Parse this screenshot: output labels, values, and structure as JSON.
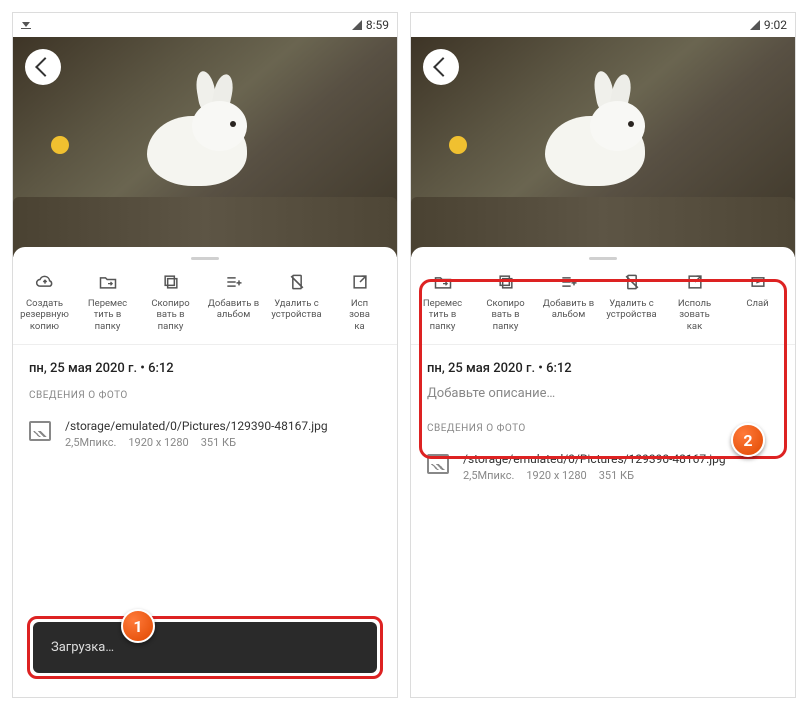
{
  "left": {
    "time": "8:59",
    "actions": [
      {
        "icon": "cloud-up",
        "label": "Создать\nрезервную\nкопию"
      },
      {
        "icon": "folder-move",
        "label": "Перемес\nтить в\nпапку"
      },
      {
        "icon": "copy",
        "label": "Скопиро\nвать в\nпапку"
      },
      {
        "icon": "list-add",
        "label": "Добавить в\nальбом"
      },
      {
        "icon": "device-x",
        "label": "Удалить с\nустройства"
      },
      {
        "icon": "external",
        "label": "Исп\nзова\nка"
      }
    ],
    "date": "пн, 25 мая 2020 г.  •  6:12",
    "section": "СВЕДЕНИЯ О ФОТО",
    "file_path": "/storage/emulated/0/Pictures/129390-48167.jpg",
    "file_meta": [
      "2,5Мпикс.",
      "1920 x 1280",
      "351 КБ"
    ],
    "toast": "Загрузка…",
    "badge": "1"
  },
  "right": {
    "time": "9:02",
    "actions": [
      {
        "icon": "folder-move",
        "label": "Перемес\nтить в\nпапку"
      },
      {
        "icon": "copy",
        "label": "Скопиро\nвать в\nпапку"
      },
      {
        "icon": "list-add",
        "label": "Добавить в\nальбом"
      },
      {
        "icon": "device-x",
        "label": "Удалить с\nустройства"
      },
      {
        "icon": "external",
        "label": "Исполь\nзовать\nкак"
      },
      {
        "icon": "slides",
        "label": "Слай"
      }
    ],
    "date": "пн, 25 мая 2020 г.  •  6:12",
    "description": "Добавьте описание…",
    "section": "СВЕДЕНИЯ О ФОТО",
    "file_path": "/storage/emulated/0/Pictures/129390-48167.jpg",
    "file_meta": [
      "2,5Мпикс.",
      "1920 x 1280",
      "351 КБ"
    ],
    "badge": "2"
  }
}
